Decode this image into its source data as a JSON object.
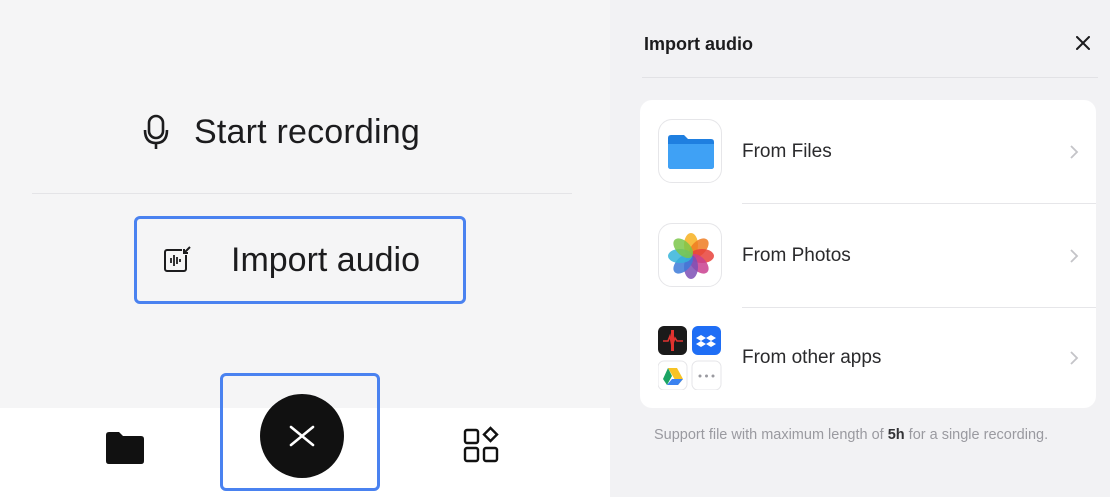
{
  "left": {
    "start_recording": "Start recording",
    "import_audio": "Import audio"
  },
  "panel": {
    "title": "Import audio",
    "options": [
      {
        "label": "From Files",
        "icon": "files-app-icon"
      },
      {
        "label": "From Photos",
        "icon": "photos-app-icon"
      },
      {
        "label": "From other apps",
        "icon": "other-apps-icon"
      }
    ],
    "note_prefix": "Support file with maximum length of ",
    "note_value": "5h",
    "note_suffix": " for a single recording."
  },
  "bottom_bar": {
    "icons": [
      "folder-icon",
      "close-icon",
      "apps-grid-icon"
    ]
  },
  "colors": {
    "highlight": "#4a82f0",
    "close_button": "#111111",
    "panel_bg": "#f2f2f4"
  }
}
